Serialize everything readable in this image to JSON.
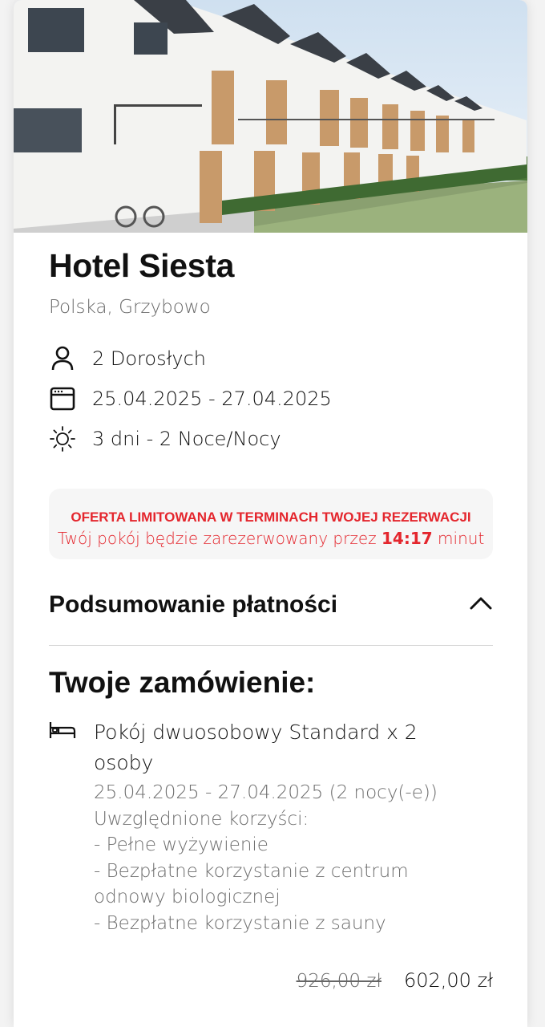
{
  "hotel": {
    "name": "Hotel Siesta",
    "location": "Polska, Grzybowo",
    "image": "hotel-photo"
  },
  "info": {
    "guests": "2 Dorosłych",
    "dates": "25.04.2025 - 27.04.2025",
    "duration": "3 dni - 2 Noce/Nocy"
  },
  "alert": {
    "title": "OFERTA LIMITOWANA W TERMINACH TWOJEJ REZERWACJI",
    "text_before": "Twój pokój będzie zarezerwowany przez",
    "time": "14:17",
    "text_after": "minut",
    "color": "#e4262d"
  },
  "summary": {
    "label": "Podsumowanie płatności",
    "icon": "chevron-up-icon"
  },
  "order": {
    "title": "Twoje zamówienie:",
    "room": "Pokój dwuosobowy Standard x 2 osoby",
    "dates": "25.04.2025 - 27.04.2025 (2 nocy(-e))",
    "benefits_label": "Uwzględnione korzyści:",
    "benefits": [
      "- Pełne wyżywienie",
      "- Bezpłatne korzystanie z centrum odnowy biologicznej",
      "- Bezpłatne korzystanie z sauny"
    ],
    "old_price": "926,00 zł",
    "price": "602,00 zł"
  }
}
